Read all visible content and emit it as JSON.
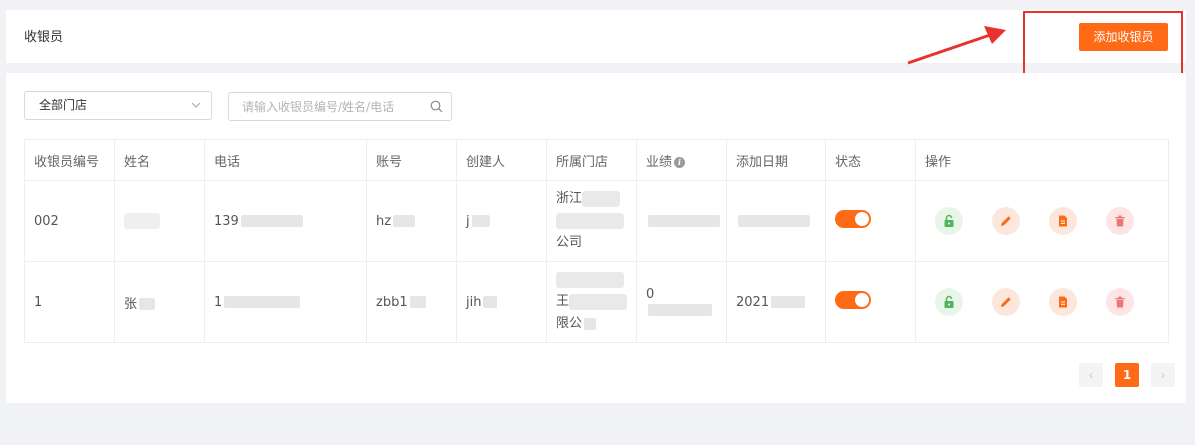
{
  "page": {
    "title": "收银员",
    "add_button_label": "添加收银员"
  },
  "filters": {
    "store_select_value": "全部门店",
    "search_placeholder": "请输入收银员编号/姓名/电话"
  },
  "table": {
    "columns": [
      "收银员编号",
      "姓名",
      "电话",
      "账号",
      "创建人",
      "所属门店",
      "业绩",
      "添加日期",
      "状态",
      "操作"
    ],
    "rows": [
      {
        "id": "002",
        "name": "",
        "phone": "139",
        "account": "hz",
        "creator": "j",
        "store_line1": "浙江",
        "store_line3": "公司",
        "performance": "",
        "date": "",
        "status_on": true
      },
      {
        "id": "1",
        "name": "张",
        "phone": "1",
        "account": "zbb1",
        "creator": "jih",
        "store_line2": "王",
        "store_line3": "限公",
        "performance": "0",
        "date": "2021",
        "status_on": true
      }
    ]
  },
  "pagination": {
    "prev": "‹",
    "current_page": "1",
    "next": "›"
  },
  "colors": {
    "accent": "#ff6a17",
    "annotation": "#e8322b"
  },
  "icons": [
    "chevron-down-icon",
    "search-icon",
    "unlock-icon",
    "pencil-icon",
    "document-icon",
    "trash-icon",
    "info-icon"
  ]
}
